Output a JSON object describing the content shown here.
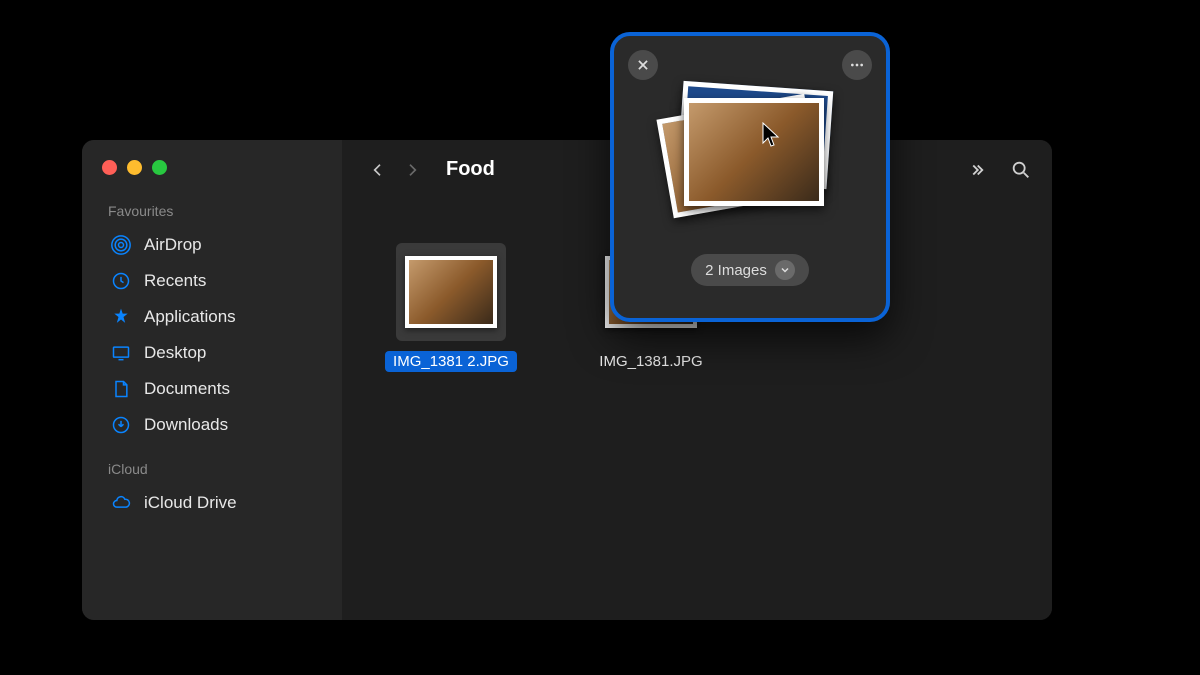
{
  "sidebar": {
    "sections": [
      {
        "label": "Favourites",
        "items": [
          {
            "label": "AirDrop",
            "icon": "airdrop-icon"
          },
          {
            "label": "Recents",
            "icon": "clock-icon"
          },
          {
            "label": "Applications",
            "icon": "apps-icon"
          },
          {
            "label": "Desktop",
            "icon": "desktop-icon"
          },
          {
            "label": "Documents",
            "icon": "document-icon"
          },
          {
            "label": "Downloads",
            "icon": "download-icon"
          }
        ]
      },
      {
        "label": "iCloud",
        "items": [
          {
            "label": "iCloud Drive",
            "icon": "cloud-icon"
          }
        ]
      }
    ]
  },
  "toolbar": {
    "title": "Food"
  },
  "files": [
    {
      "name": "IMG_1381 2.JPG",
      "selected": true
    },
    {
      "name": "IMG_1381.JPG",
      "selected": false
    }
  ],
  "popover": {
    "count_label": "2 Images"
  }
}
